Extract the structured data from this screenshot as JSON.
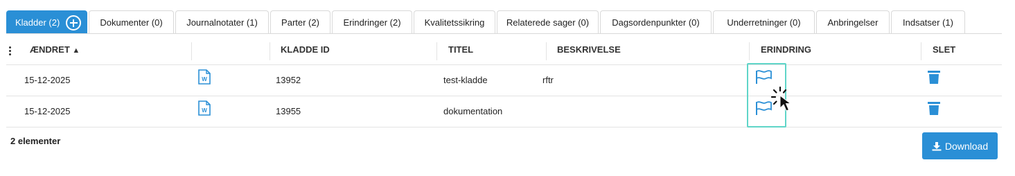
{
  "tabs": [
    {
      "label": "Kladder (2)"
    },
    {
      "label": "Dokumenter (0)"
    },
    {
      "label": "Journalnotater (1)"
    },
    {
      "label": "Parter (2)"
    },
    {
      "label": "Erindringer (2)"
    },
    {
      "label": "Kvalitetssikring"
    },
    {
      "label": "Relaterede sager (0)"
    },
    {
      "label": "Dagsordenpunkter (0)"
    },
    {
      "label": "Underretninger (0)"
    },
    {
      "label": "Anbringelser"
    },
    {
      "label": "Indsatser  (1)"
    }
  ],
  "table": {
    "headers": {
      "changed": "ÆNDRET",
      "sort_indicator": "▲",
      "draft_id": "KLADDE ID",
      "title": "TITEL",
      "description": "BESKRIVELSE",
      "reminder": "ERINDRING",
      "delete": "SLET"
    },
    "rows": [
      {
        "changed": "15-12-2025",
        "draft_id": "13952",
        "title": "test-kladde",
        "description": "rftr"
      },
      {
        "changed": "15-12-2025",
        "draft_id": "13955",
        "title": "dokumentation",
        "description": ""
      }
    ]
  },
  "footer": {
    "count": "2 elementer",
    "download_label": "Download"
  },
  "colors": {
    "accent": "#2a8fd6",
    "highlight": "#5fd5c8"
  },
  "icons": {
    "add": "plus-circle-icon",
    "word": "word-document-icon",
    "flag": "flag-icon",
    "trash": "trash-icon",
    "download": "download-icon",
    "menu": "kebab-menu-icon"
  }
}
